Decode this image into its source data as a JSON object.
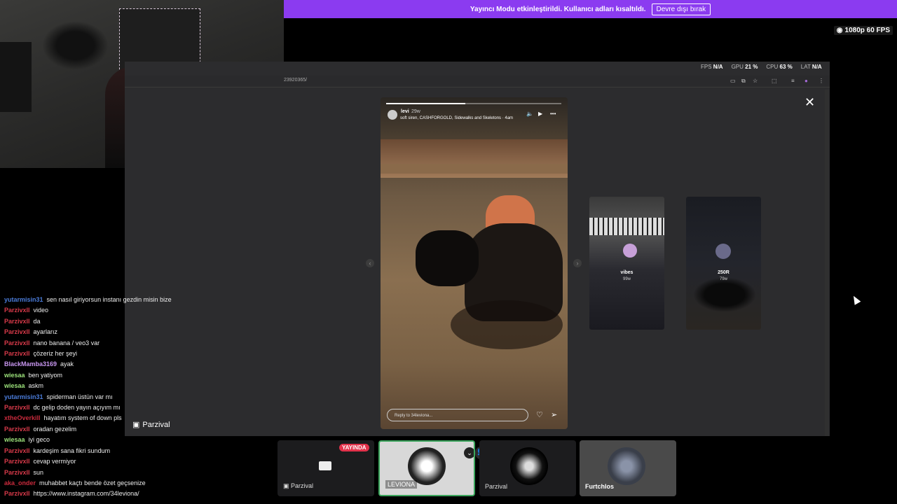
{
  "banner": {
    "text": "Yayıncı Modu etkinleştirildi. Kullanıcı adları kısaltıldı.",
    "button": "Devre dışı bırak"
  },
  "quality": "1080p 60 FPS",
  "stats": {
    "fps_label": "FPS",
    "fps_value": "N/A",
    "gpu_label": "GPU",
    "gpu_value": "21 %",
    "cpu_label": "CPU",
    "cpu_value": "63 %",
    "lat_label": "LAT",
    "lat_value": "N/A"
  },
  "browser": {
    "url_fragment": "23920365/"
  },
  "story": {
    "user": "levi",
    "time": "29w",
    "music": "soft siren, CASHFORGOLD, Sidewalks and Skeletons · 4am",
    "reply_placeholder": "Reply to 34leviona..."
  },
  "previews": [
    {
      "label": "vibes",
      "sub": "99w"
    },
    {
      "label": "250R",
      "sub": "79w"
    }
  ],
  "chat": [
    {
      "user": "yutarmisin31",
      "color": "#4a7bd8",
      "msg": "sen nasıl giriyorsun instanı gezdin misin bize"
    },
    {
      "user": "Parzivxll",
      "color": "#d93a4a",
      "msg": "video"
    },
    {
      "user": "Parzivxll",
      "color": "#d93a4a",
      "msg": "da"
    },
    {
      "user": "Parzivxll",
      "color": "#d93a4a",
      "msg": "ayarlarız"
    },
    {
      "user": "Parzivxll",
      "color": "#d93a4a",
      "msg": "nano banana / veo3 var"
    },
    {
      "user": "Parzivxll",
      "color": "#d93a4a",
      "msg": "çözeriz her şeyi"
    },
    {
      "user": "BlackMamba3169",
      "color": "#c896f0",
      "msg": "ayak"
    },
    {
      "user": "wiesaa",
      "color": "#9be07a",
      "msg": "ben yatiyom"
    },
    {
      "user": "wiesaa",
      "color": "#9be07a",
      "msg": "askm"
    },
    {
      "user": "yutarmisin31",
      "color": "#4a7bd8",
      "msg": "spiderman üstün var mı"
    },
    {
      "user": "Parzivxll",
      "color": "#d93a4a",
      "msg": "dc gelip doden yayın açıyım mı"
    },
    {
      "user": "xtheOverkill",
      "color": "#c82a3c",
      "msg": "hayatım system of down pls"
    },
    {
      "user": "Parzivxll",
      "color": "#d93a4a",
      "msg": "oradan gezelim"
    },
    {
      "user": "wiesaa",
      "color": "#9be07a",
      "msg": "iyi geco"
    },
    {
      "user": "Parzivxll",
      "color": "#d93a4a",
      "msg": "kardeşim sana fikri sundum"
    },
    {
      "user": "Parzivxll",
      "color": "#d93a4a",
      "msg": "cevap vermiyor"
    },
    {
      "user": "Parzivxll",
      "color": "#d93a4a",
      "msg": "sun"
    },
    {
      "user": "aka_onder",
      "color": "#c82a3c",
      "msg": "muhabbet kaçtı bende özet geçsenize"
    },
    {
      "user": "Parzivxll",
      "color": "#d93a4a",
      "msg": "https://www.instagram.com/34leviona/"
    }
  ],
  "stream_tag": "Parzival",
  "tiles": [
    {
      "name": "Parzival",
      "badge": "YAYINDA"
    },
    {
      "name": "LEVIONA"
    },
    {
      "name": "Parzival"
    },
    {
      "name": "Furtchlos"
    }
  ]
}
